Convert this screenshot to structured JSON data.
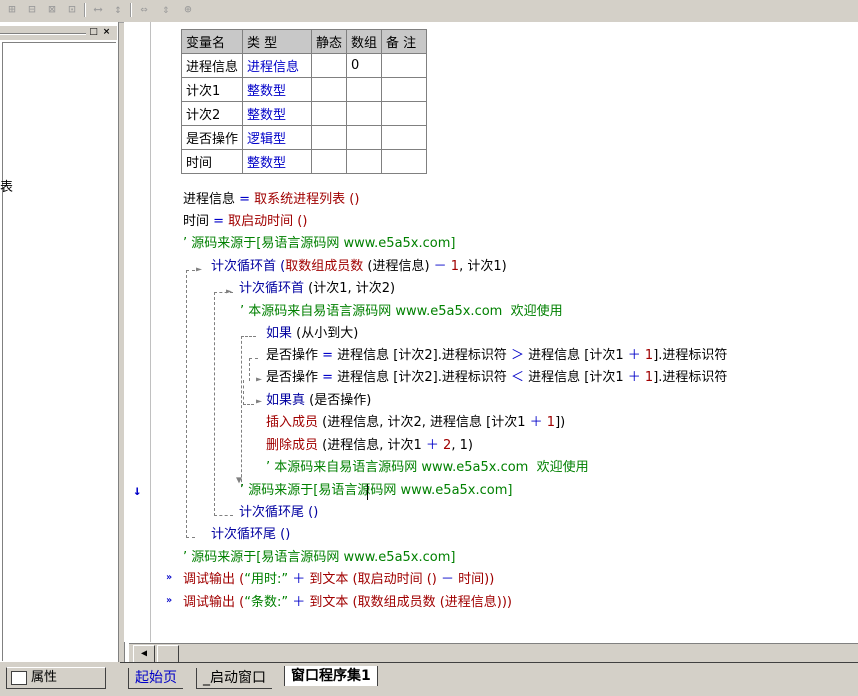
{
  "toolbar": {
    "icons": [
      "align-left-icon",
      "align-center-icon",
      "align-top-icon",
      "align-distribute-icon",
      "space-horizontal-icon",
      "space-vertical-icon",
      "fit-width-icon",
      "fit-height-icon",
      "center-icon"
    ]
  },
  "left_panel": {
    "partial_text": "表",
    "properties_tab_label": "属性",
    "minimize_label": "□",
    "close_label": "×"
  },
  "var_table": {
    "headers": [
      "变量名",
      "类 型",
      "静态",
      "数组",
      "备 注"
    ],
    "rows": [
      [
        "进程信息",
        "进程信息",
        "",
        "0",
        ""
      ],
      [
        "计次1",
        "整数型",
        "",
        "",
        ""
      ],
      [
        "计次2",
        "整数型",
        "",
        "",
        ""
      ],
      [
        "是否操作",
        "逻辑型",
        "",
        "",
        ""
      ],
      [
        "时间",
        "整数型",
        "",
        "",
        ""
      ]
    ]
  },
  "code": {
    "l1": {
      "a": "进程信息 ",
      "b": "=",
      "c": " 取系统进程列表 ()"
    },
    "l2": {
      "a": "时间 ",
      "b": "=",
      "c": " 取启动时间 ()"
    },
    "l3": "’ 源码来源于[易语言源码网 www.e5a5x.com]",
    "l4": {
      "a": "计次循环首 (",
      "b": "取数组成员数",
      "c": " (进程信息) ",
      "d": "－",
      "e": " 1",
      "f": ", 计次1)"
    },
    "l5": {
      "a": "计次循环首 ",
      "b": "(计次1, 计次2)"
    },
    "l6": "’ 本源码来自易语言源码网 www.e5a5x.com  欢迎使用",
    "l7": {
      "a": "如果 ",
      "b": "(从小到大)"
    },
    "l8": {
      "a": "是否操作 ",
      "b": "=",
      "c": " 进程信息 [计次2].进程标识符 ",
      "d": "＞",
      "e": " 进程信息 [计次1 ",
      "f": "＋",
      "g": " 1",
      "h": "].进程标识符"
    },
    "l9": {
      "a": "是否操作 ",
      "b": "=",
      "c": " 进程信息 [计次2].进程标识符 ",
      "d": "＜",
      "e": " 进程信息 [计次1 ",
      "f": "＋",
      "g": " 1",
      "h": "].进程标识符"
    },
    "l10": {
      "a": "如果真 ",
      "b": "(是否操作)"
    },
    "l11": {
      "a": "插入成员",
      "b": " (进程信息, 计次2, 进程信息 [计次1 ",
      "c": "＋",
      "d": " 1",
      "e": "])"
    },
    "l12": {
      "a": "删除成员",
      "b": " (进程信息, 计次1 ",
      "c": "＋",
      "d": " 2",
      "e": ", 1)"
    },
    "l13": "’ 本源码来自易语言源码网 www.e5a5x.com  欢迎使用",
    "l14": "’ 源码来源于[易语言源码网 www.e5a5x.com]",
    "l15": "计次循环尾 ()",
    "l16": "计次循环尾 ()",
    "l17": "’ 源码来源于[易语言源码网 www.e5a5x.com]",
    "l18": {
      "a": "调试输出 (",
      "b": "“用时:”",
      "c": " ",
      "d": "＋",
      "e": " 到文本 (取启动时间 () ",
      "f": "－",
      "g": " 时间))"
    },
    "l19": {
      "a": "调试输出 (",
      "b": "“条数:”",
      "c": " ",
      "d": "＋",
      "e": " 到文本 (取数组成员数 (进程信息)))"
    }
  },
  "tabs": [
    "起始页",
    "_启动窗口",
    "窗口程序集1"
  ],
  "colors": {
    "function": "#a00000",
    "comment": "#008000",
    "type": "#0000c8"
  }
}
